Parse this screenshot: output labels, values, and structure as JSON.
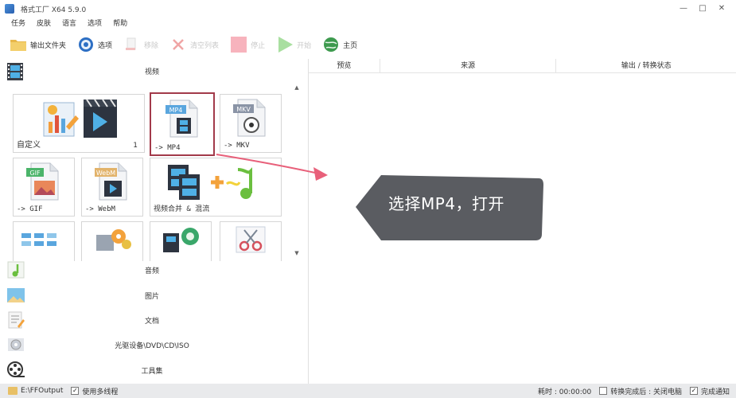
{
  "window": {
    "title": "格式工厂 X64 5.9.0",
    "controls": [
      "—",
      "□",
      "✕"
    ]
  },
  "menu": [
    "任务",
    "皮肤",
    "语言",
    "选项",
    "帮助"
  ],
  "toolbar": {
    "output_folder": "输出文件夹",
    "options": "选项",
    "remove": "移除",
    "clear_list": "清空列表",
    "stop": "停止",
    "start": "开始",
    "home": "主页"
  },
  "video_section": {
    "title": "视频",
    "tiles": [
      {
        "label": "自定义",
        "count": "1"
      },
      {
        "label": "-> MP4",
        "badge": "MP4"
      },
      {
        "label": "-> MKV",
        "badge": "MKV"
      },
      {
        "label": "-> GIF",
        "badge": "GIF"
      },
      {
        "label": "-> WebM",
        "badge": "WebM"
      },
      {
        "label": "视频合并 & 混流"
      }
    ]
  },
  "categories": [
    "音频",
    "图片",
    "文档",
    "光驱设备\\DVD\\CD\\ISO",
    "工具集"
  ],
  "task_list": {
    "columns": [
      "预览",
      "来源",
      "输出 / 转换状态"
    ]
  },
  "annotation": {
    "text": "选择MP4，打开"
  },
  "statusbar": {
    "output_path": "E:\\FFOutput",
    "multithread": "使用多线程",
    "elapsed": "耗时 : 00:00:00",
    "after_convert": "转换完成后 : 关闭电脑",
    "notify": "完成通知"
  },
  "colors": {
    "selected_border": "#a23a4a",
    "callout_bg": "#5a5c61",
    "arrow": "#e8607a",
    "statusbar_bg": "#e9eaec"
  }
}
